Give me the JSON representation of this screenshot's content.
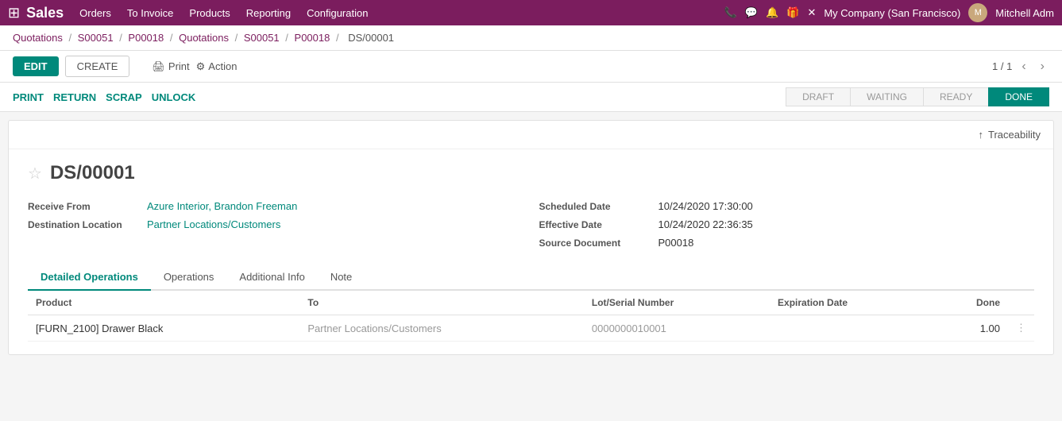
{
  "topbar": {
    "brand": "Sales",
    "nav_items": [
      "Orders",
      "To Invoice",
      "Products",
      "Reporting",
      "Configuration"
    ],
    "company": "My Company (San Francisco)",
    "user": "Mitchell Adm"
  },
  "breadcrumb": {
    "items": [
      "Quotations",
      "S00051",
      "P00018",
      "Quotations",
      "S00051",
      "P00018",
      "DS/00001"
    ],
    "separators": [
      "/",
      "/",
      "/",
      "/",
      "/",
      "/"
    ]
  },
  "toolbar": {
    "edit_label": "EDIT",
    "create_label": "CREATE",
    "print_label": "Print",
    "action_label": "Action",
    "pagination": "1 / 1"
  },
  "status_bar": {
    "buttons": [
      "PRINT",
      "RETURN",
      "SCRAP",
      "UNLOCK"
    ],
    "steps": [
      {
        "label": "DRAFT",
        "active": false
      },
      {
        "label": "WAITING",
        "active": false
      },
      {
        "label": "READY",
        "active": false
      },
      {
        "label": "DONE",
        "active": true
      }
    ]
  },
  "record": {
    "id": "DS/00001",
    "traceability_label": "Traceability",
    "fields": {
      "receive_from_label": "Receive From",
      "receive_from_value": "Azure Interior, Brandon Freeman",
      "destination_label": "Destination Location",
      "destination_value": "Partner Locations/Customers",
      "scheduled_date_label": "Scheduled Date",
      "scheduled_date_value": "10/24/2020 17:30:00",
      "effective_date_label": "Effective Date",
      "effective_date_value": "10/24/2020 22:36:35",
      "source_doc_label": "Source Document",
      "source_doc_value": "P00018"
    }
  },
  "tabs": [
    {
      "label": "Detailed Operations",
      "active": true
    },
    {
      "label": "Operations",
      "active": false
    },
    {
      "label": "Additional Info",
      "active": false
    },
    {
      "label": "Note",
      "active": false
    }
  ],
  "table": {
    "columns": [
      "Product",
      "To",
      "Lot/Serial Number",
      "Expiration Date",
      "Done",
      ""
    ],
    "rows": [
      {
        "product": "[FURN_2100] Drawer Black",
        "to": "Partner Locations/Customers",
        "lot_serial": "0000000010001",
        "expiration_date": "",
        "done": "1.00"
      }
    ]
  }
}
